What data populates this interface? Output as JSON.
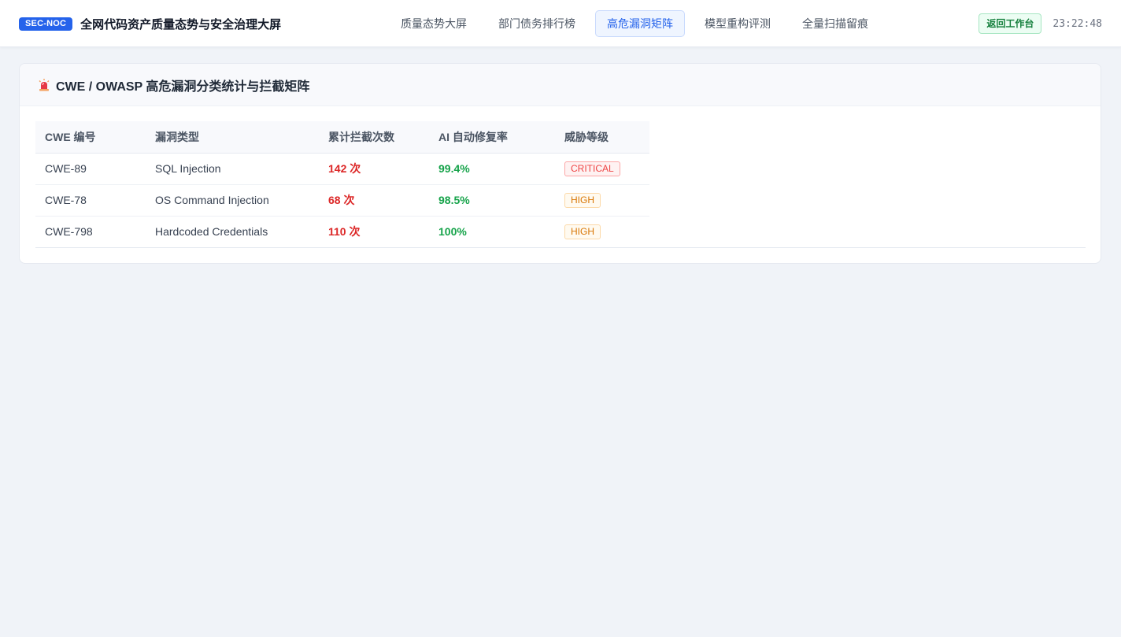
{
  "header": {
    "badge": "SEC-NOC",
    "title": "全网代码资产质量态势与安全治理大屏",
    "tabs": [
      {
        "label": "质量态势大屏",
        "active": false
      },
      {
        "label": "部门债务排行榜",
        "active": false
      },
      {
        "label": "高危漏洞矩阵",
        "active": true
      },
      {
        "label": "模型重构评测",
        "active": false
      },
      {
        "label": "全量扫描留痕",
        "active": false
      }
    ],
    "back_label": "返回工作台",
    "clock": "23:22:48"
  },
  "panel": {
    "icon": "siren-icon",
    "title": "CWE / OWASP 高危漏洞分类统计与拦截矩阵",
    "columns": [
      "CWE 编号",
      "漏洞类型",
      "累计拦截次数",
      "AI 自动修复率",
      "威胁等级"
    ],
    "rows": [
      {
        "cwe": "CWE-89",
        "type": "SQL Injection",
        "count": "142 次",
        "rate": "99.4%",
        "level": "CRITICAL"
      },
      {
        "cwe": "CWE-78",
        "type": "OS Command Injection",
        "count": "68 次",
        "rate": "98.5%",
        "level": "HIGH"
      },
      {
        "cwe": "CWE-798",
        "type": "Hardcoded Credentials",
        "count": "110 次",
        "rate": "100%",
        "level": "HIGH"
      }
    ]
  },
  "colors": {
    "accent": "#2563eb",
    "danger": "#dc2626",
    "success": "#16a34a",
    "critical_bg": "#fef2f2",
    "critical_border": "#fca5a5",
    "critical_text": "#ef4444",
    "high_bg": "#fffaf0",
    "high_border": "#fcd9a8",
    "high_text": "#d97706"
  }
}
